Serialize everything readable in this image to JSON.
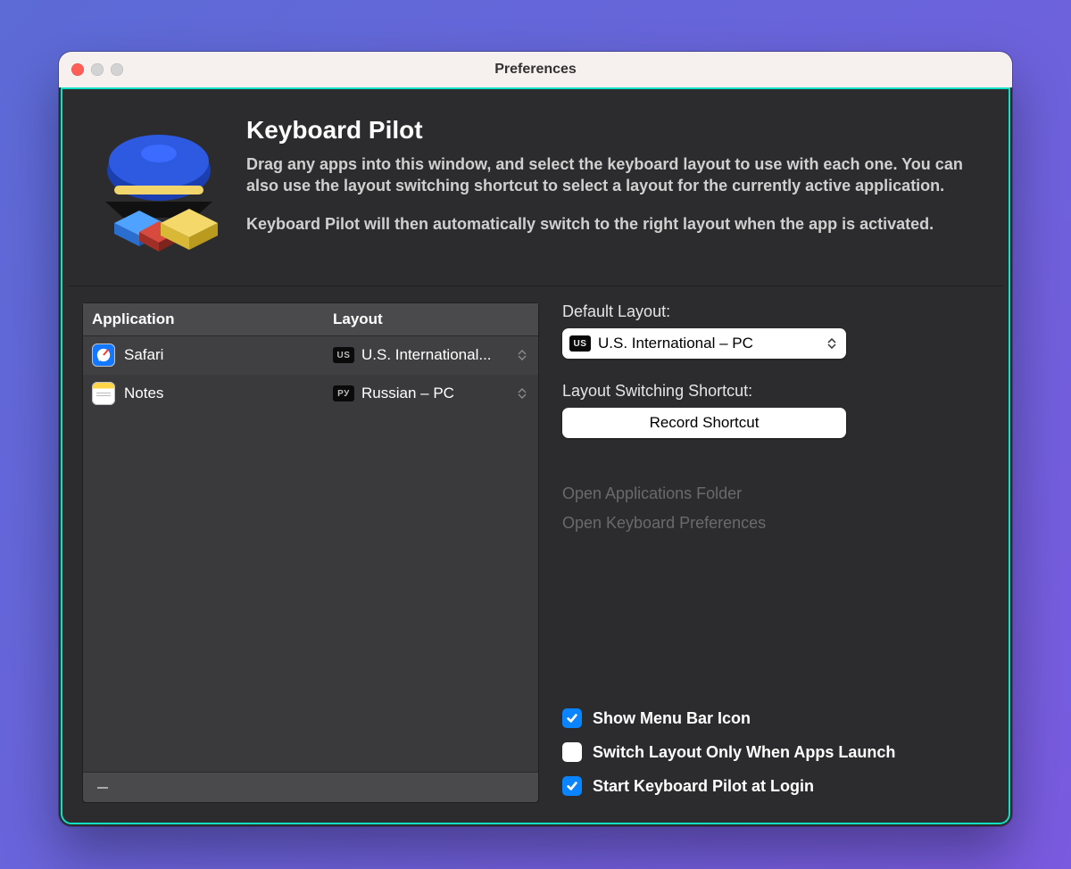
{
  "window": {
    "title": "Preferences"
  },
  "header": {
    "app_name": "Keyboard Pilot",
    "paragraph1": "Drag any apps into this window, and select the keyboard layout to use with each one. You can also use the layout switching shortcut to select a layout for the currently active application.",
    "paragraph2": "Keyboard Pilot will then automatically switch to the right layout when the app is activated."
  },
  "apps_table": {
    "col_app": "Application",
    "col_layout": "Layout",
    "rows": [
      {
        "app": "Safari",
        "icon": "safari",
        "layout": "U.S. International...",
        "badge": "US"
      },
      {
        "app": "Notes",
        "icon": "notes",
        "layout": "Russian – PC",
        "badge": "РУ"
      }
    ]
  },
  "side": {
    "default_layout_label": "Default Layout:",
    "default_layout_value": "U.S. International – PC",
    "default_layout_badge": "US",
    "shortcut_label": "Layout Switching Shortcut:",
    "shortcut_button": "Record Shortcut",
    "open_apps_folder": "Open Applications Folder",
    "open_kb_prefs": "Open Keyboard Preferences"
  },
  "checks": {
    "show_menu_bar": {
      "label": "Show Menu Bar Icon",
      "checked": true
    },
    "switch_on_launch": {
      "label": "Switch Layout Only When Apps Launch",
      "checked": false
    },
    "start_at_login": {
      "label": "Start Keyboard Pilot at Login",
      "checked": true
    }
  }
}
